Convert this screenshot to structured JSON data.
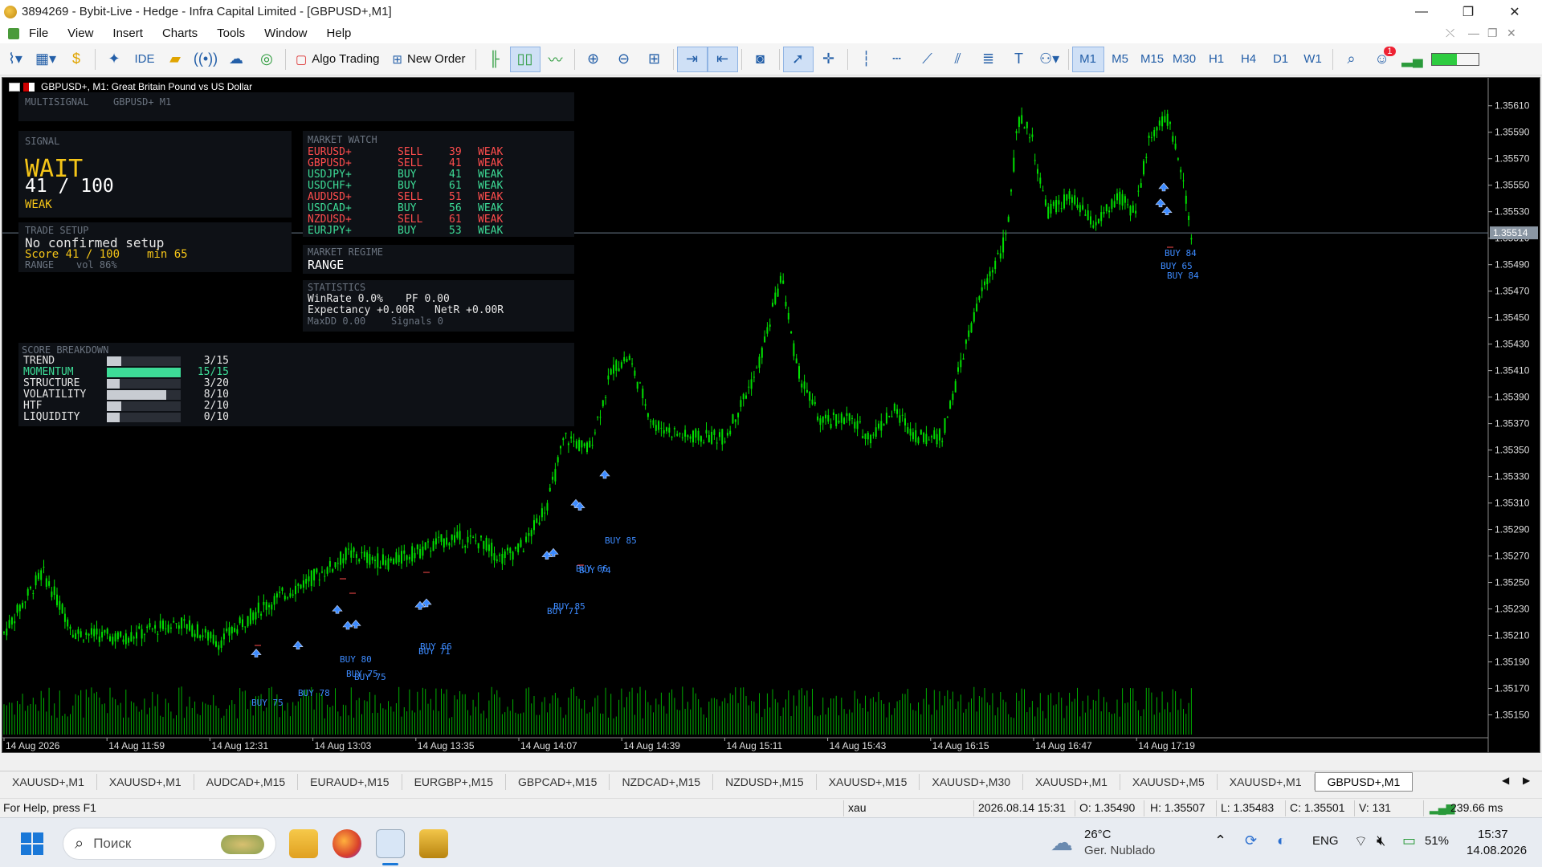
{
  "window": {
    "title": "3894269 - Bybit-Live - Hedge - Infra Capital Limited - [GBPUSD+,M1]",
    "minimize": "—",
    "restore": "❐",
    "close": "✕"
  },
  "menu": {
    "items": [
      "File",
      "View",
      "Insert",
      "Charts",
      "Tools",
      "Window",
      "Help"
    ],
    "inner_controls": [
      "⤬",
      "—",
      "❐",
      "✕"
    ]
  },
  "toolbar": {
    "algo_trading": "Algo Trading",
    "new_order": "New Order",
    "ide": "IDE",
    "timeframes": [
      "M1",
      "M5",
      "M15",
      "M30",
      "H1",
      "H4",
      "D1",
      "W1"
    ],
    "active_timeframe": "M1",
    "notifications": "1"
  },
  "chart": {
    "header": "GBPUSD+, M1:  Great Britain Pound vs US Dollar",
    "current_price": "1.35514",
    "price_labels": [
      "1.35610",
      "1.35590",
      "1.35570",
      "1.35550",
      "1.35530",
      "1.35510",
      "1.35490",
      "1.35470",
      "1.35450",
      "1.35430",
      "1.35410",
      "1.35390",
      "1.35370",
      "1.35350",
      "1.35330",
      "1.35310",
      "1.35290",
      "1.35270",
      "1.35250",
      "1.35230",
      "1.35210",
      "1.35190",
      "1.35170",
      "1.35150"
    ],
    "time_labels": [
      "14 Aug 2026",
      "14 Aug 11:59",
      "14 Aug 12:31",
      "14 Aug 13:03",
      "14 Aug 13:35",
      "14 Aug 14:07",
      "14 Aug 14:39",
      "14 Aug 15:11",
      "14 Aug 15:43",
      "14 Aug 16:15",
      "14 Aug 16:47",
      "14 Aug 17:19"
    ],
    "buy_labels": [
      "BUY 85",
      "BUY 66",
      "BUY 74",
      "BUY 85",
      "BUY 71",
      "BUY 80",
      "BUY 66",
      "BUY 71",
      "BUY 75",
      "BUY 75",
      "BUY 78",
      "BUY 75",
      "BUY 84",
      "BUY 65",
      "BUY 84"
    ]
  },
  "dashboard": {
    "header": "MULTISIGNAL",
    "header_symbol": "GBPUSD+ M1",
    "signal": {
      "label": "SIGNAL",
      "state": "WAIT",
      "score": "41 / 100",
      "strength": "WEAK"
    },
    "trade_setup": {
      "label": "TRADE SETUP",
      "status": "No confirmed setup",
      "score_text": "Score 41 / 100",
      "min_text": "min 65",
      "regime": "RANGE",
      "vol": "vol 86%"
    },
    "market_watch": {
      "label": "MARKET WATCH",
      "rows": [
        {
          "symbol": "EURUSD+",
          "side": "SELL",
          "score": "39",
          "strength": "WEAK"
        },
        {
          "symbol": "GBPUSD+",
          "side": "SELL",
          "score": "41",
          "strength": "WEAK"
        },
        {
          "symbol": "USDJPY+",
          "side": "BUY",
          "score": "41",
          "strength": "WEAK"
        },
        {
          "symbol": "USDCHF+",
          "side": "BUY",
          "score": "61",
          "strength": "WEAK"
        },
        {
          "symbol": "AUDUSD+",
          "side": "SELL",
          "score": "51",
          "strength": "WEAK"
        },
        {
          "symbol": "USDCAD+",
          "side": "BUY",
          "score": "56",
          "strength": "WEAK"
        },
        {
          "symbol": "NZDUSD+",
          "side": "SELL",
          "score": "61",
          "strength": "WEAK"
        },
        {
          "symbol": "EURJPY+",
          "side": "BUY",
          "score": "53",
          "strength": "WEAK"
        }
      ]
    },
    "market_regime": {
      "label": "MARKET REGIME",
      "value": "RANGE"
    },
    "statistics": {
      "label": "STATISTICS",
      "winrate": "WinRate 0.0%",
      "pf": "PF 0.00",
      "expectancy": "Expectancy +0.00R",
      "netr": "NetR +0.00R",
      "maxdd": "MaxDD 0.00",
      "signals": "Signals 0"
    },
    "score_breakdown": {
      "label": "SCORE BREAKDOWN",
      "rows": [
        {
          "name": "TREND",
          "value": "3/15",
          "fill": 0.2
        },
        {
          "name": "MOMENTUM",
          "value": "15/15",
          "fill": 1.0
        },
        {
          "name": "STRUCTURE",
          "value": "3/20",
          "fill": 0.15
        },
        {
          "name": "VOLATILITY",
          "value": "8/10",
          "fill": 0.8
        },
        {
          "name": "HTF",
          "value": "2/10",
          "fill": 0.2
        },
        {
          "name": "LIQUIDITY",
          "value": "0/10",
          "fill": 0.0
        }
      ]
    }
  },
  "chart_tabs": [
    "XAUUSD+,M1",
    "XAUUSD+,M1",
    "AUDCAD+,M15",
    "EURAUD+,M15",
    "EURGBP+,M15",
    "GBPCAD+,M15",
    "NZDCAD+,M15",
    "NZDUSD+,M15",
    "XAUUSD+,M15",
    "XAUUSD+,M30",
    "XAUUSD+,M1",
    "XAUUSD+,M5",
    "XAUUSD+,M1",
    "GBPUSD+,M1"
  ],
  "active_chart_tab": "GBPUSD+,M1",
  "statusbar": {
    "help": "For Help, press F1",
    "profile": "xau",
    "datetime": "2026.08.14 15:31",
    "open": "O: 1.35490",
    "high": "H: 1.35507",
    "low": "L: 1.35483",
    "close": "C: 1.35501",
    "volume": "V: 131",
    "ping": "239.66 ms"
  },
  "taskbar": {
    "search_placeholder": "Поиск",
    "weather_temp": "26°C",
    "weather_desc": "Ger. Nublado",
    "language": "ENG",
    "battery": "51%",
    "time": "15:37",
    "date": "14.08.2026"
  },
  "colors": {
    "candle": "#00e000",
    "buy_arrow": "#3d8bff",
    "sell": "#ff4d4d",
    "momentum": "#3ddc97",
    "signal_wait": "#f5c518"
  }
}
